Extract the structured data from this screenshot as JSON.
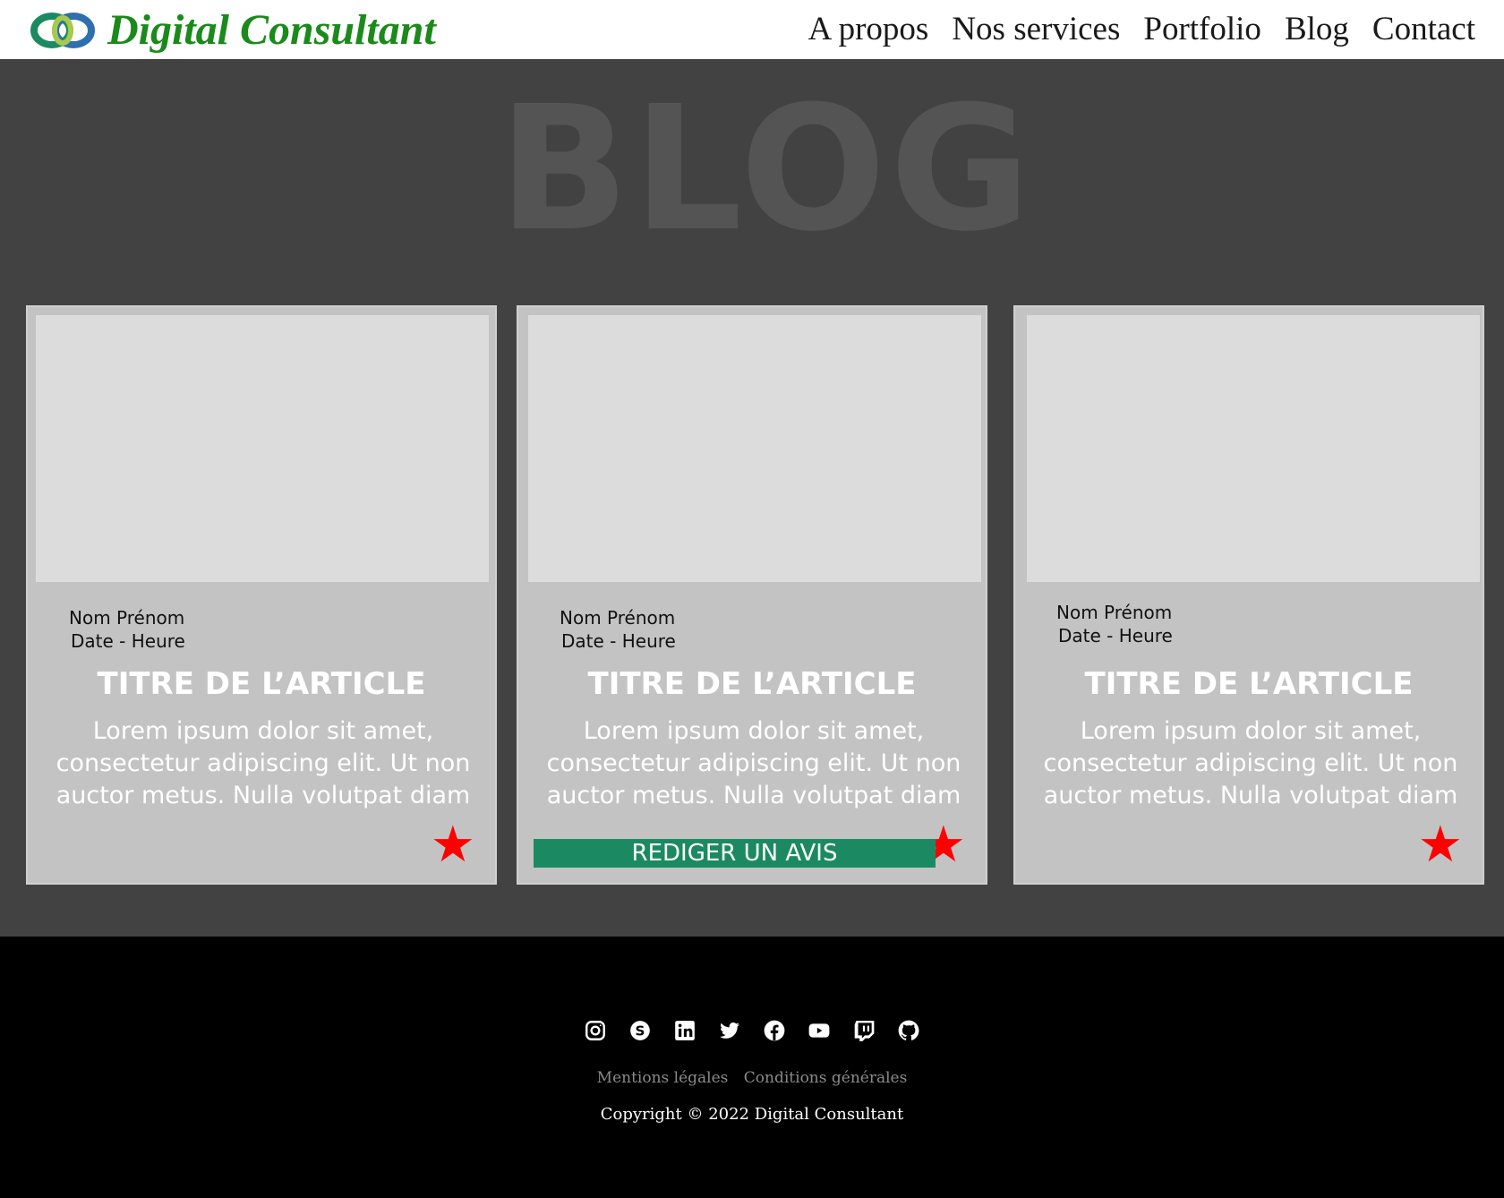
{
  "header": {
    "brand": "Digital Consultant",
    "nav": [
      "A propos",
      "Nos services",
      "Portfolio",
      "Blog",
      "Contact"
    ]
  },
  "hero": {
    "title": "BLOG"
  },
  "articles": [
    {
      "author": "Nom Prénom",
      "datetime": "Date - Heure",
      "title": "TITRE DE L’ARTICLE",
      "excerpt": "Lorem ipsum dolor sit amet, consectetur adipiscing elit. Ut non auctor metus. Nulla volutpat diam"
    },
    {
      "author": "Nom Prénom",
      "datetime": "Date - Heure",
      "title": "TITRE DE L’ARTICLE",
      "excerpt": "Lorem ipsum dolor sit amet, consectetur adipiscing elit. Ut non auctor metus. Nulla volutpat diam"
    },
    {
      "author": "Nom Prénom",
      "datetime": "Date - Heure",
      "title": "TITRE DE L’ARTICLE",
      "excerpt": "Lorem ipsum dolor sit amet, consectetur adipiscing elit. Ut non auctor metus. Nulla volutpat diam"
    }
  ],
  "review_button": "REDIGER UN AVIS",
  "footer": {
    "social_icons": [
      "instagram-icon",
      "skype-icon",
      "linkedin-icon",
      "twitter-icon",
      "facebook-icon",
      "youtube-icon",
      "twitch-icon",
      "github-icon"
    ],
    "legal_links": [
      "Mentions légales",
      "Conditions générales"
    ],
    "copyright": "Copyright © 2022 Digital Consultant"
  },
  "colors": {
    "brand_green": "#1a8a1a",
    "button_green": "#1b8a63",
    "star_red": "#ff0000",
    "section_bg": "#424242",
    "card_bg": "#c3c3c3"
  }
}
